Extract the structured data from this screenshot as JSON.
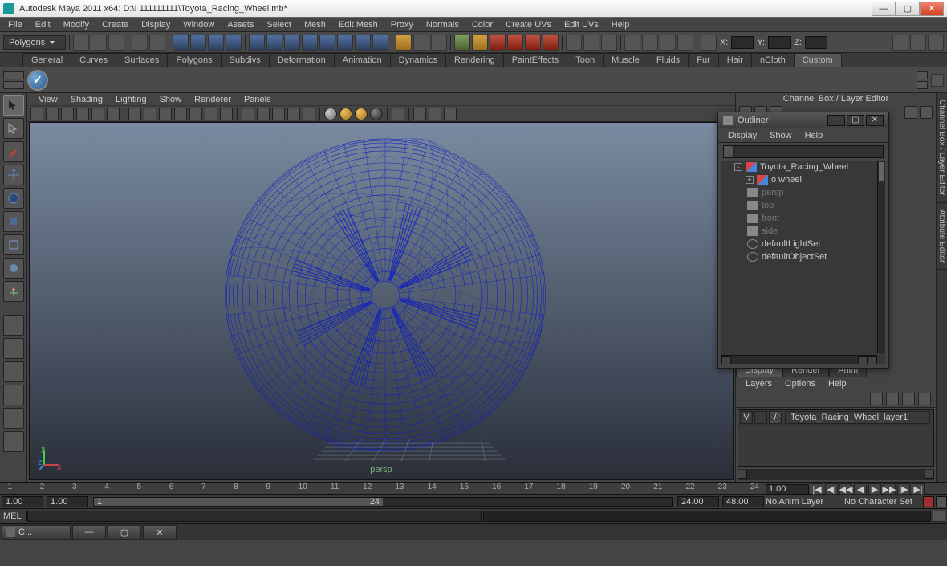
{
  "window": {
    "title": "Autodesk Maya 2011 x64: D:\\! 111111111\\Toyota_Racing_Wheel.mb*"
  },
  "menu": [
    "File",
    "Edit",
    "Modify",
    "Create",
    "Display",
    "Window",
    "Assets",
    "Select",
    "Mesh",
    "Edit Mesh",
    "Proxy",
    "Normals",
    "Color",
    "Create UVs",
    "Edit UVs",
    "Help"
  ],
  "mode_dropdown": "Polygons",
  "coords": {
    "x_label": "X:",
    "y_label": "Y:",
    "z_label": "Z:"
  },
  "shelf_tabs": [
    "General",
    "Curves",
    "Surfaces",
    "Polygons",
    "Subdivs",
    "Deformation",
    "Animation",
    "Dynamics",
    "Rendering",
    "PaintEffects",
    "Toon",
    "Muscle",
    "Fluids",
    "Fur",
    "Hair",
    "nCloth",
    "Custom"
  ],
  "shelf_active": "Custom",
  "viewport_menu": [
    "View",
    "Shading",
    "Lighting",
    "Show",
    "Renderer",
    "Panels"
  ],
  "camera_name": "persp",
  "outliner": {
    "title": "Outliner",
    "menu": [
      "Display",
      "Show",
      "Help"
    ],
    "items": [
      {
        "label": "Toyota_Racing_Wheel",
        "type": "mesh",
        "expander": "-",
        "indent": 1
      },
      {
        "label": "wheel",
        "type": "mesh",
        "expander": "+",
        "indent": 2,
        "prefix": "o "
      },
      {
        "label": "persp",
        "type": "cam",
        "dim": true,
        "indent": 1
      },
      {
        "label": "top",
        "type": "cam",
        "dim": true,
        "indent": 1
      },
      {
        "label": "front",
        "type": "cam",
        "dim": true,
        "indent": 1
      },
      {
        "label": "side",
        "type": "cam",
        "dim": true,
        "indent": 1
      },
      {
        "label": "defaultLightSet",
        "type": "set",
        "indent": 1
      },
      {
        "label": "defaultObjectSet",
        "type": "set",
        "indent": 1
      }
    ]
  },
  "channelbox_title": "Channel Box / Layer Editor",
  "vert_tabs": [
    "Channel Box / Layer Editor",
    "Attribute Editor"
  ],
  "layer_editor": {
    "tabs": [
      "Display",
      "Render",
      "Anim"
    ],
    "active": "Display",
    "menu": [
      "Layers",
      "Options",
      "Help"
    ],
    "row": {
      "vis": "V",
      "name": "Toyota_Racing_Wheel_layer1"
    }
  },
  "timeline": {
    "ticks": [
      "1",
      "2",
      "3",
      "4",
      "5",
      "6",
      "7",
      "8",
      "9",
      "10",
      "11",
      "12",
      "13",
      "14",
      "15",
      "16",
      "17",
      "18",
      "19",
      "20",
      "21",
      "22",
      "23",
      "24"
    ],
    "current_frame": "1.00",
    "start1": "1.00",
    "start2": "1.00",
    "cur": "1",
    "end1": "24",
    "end2": "24.00",
    "end3": "48.00"
  },
  "anim_layer_dd": "No Anim Layer",
  "char_set_dd": "No Character Set",
  "cmd_label": "MEL",
  "taskbar_label": "C..."
}
